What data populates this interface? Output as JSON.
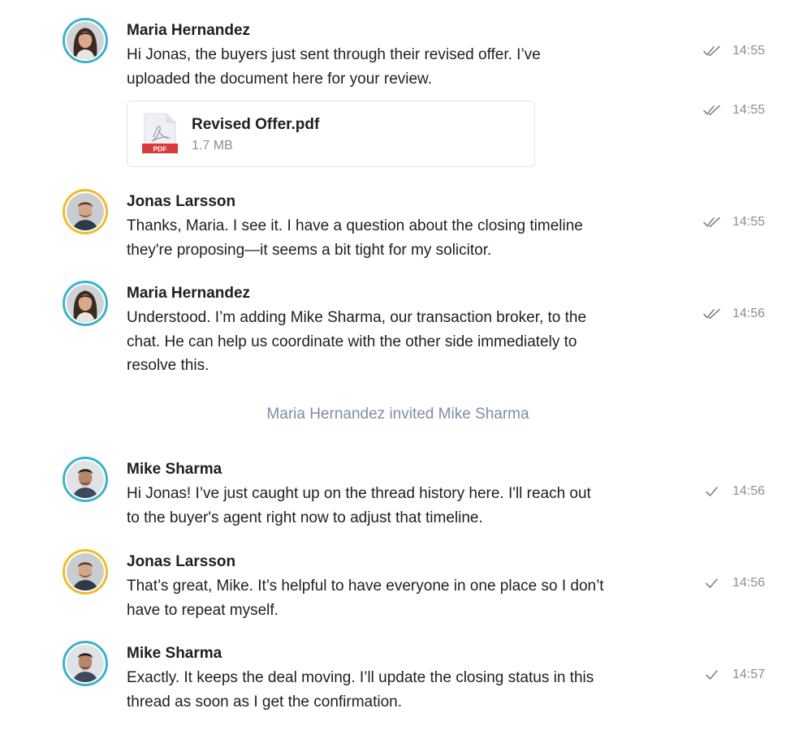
{
  "messages": [
    {
      "sender": "Maria Hernandez",
      "lines": [
        "Hi Jonas, the buyers just sent through their revised offer. I’ve",
        "uploaded the document here for your review."
      ],
      "time": "14:55",
      "status": "read",
      "avatar": "maria-avatar"
    },
    {
      "attachment": {
        "name": "Revised Offer.pdf",
        "size": "1.7 MB",
        "badge": "PDF"
      },
      "time": "14:55",
      "status": "read"
    },
    {
      "sender": "Jonas Larsson",
      "lines": [
        "Thanks, Maria. I see it. I have a question about the closing timeline",
        "they're proposing—it seems a bit tight for my solicitor."
      ],
      "time": "14:55",
      "status": "read",
      "avatar": "jonas-avatar"
    },
    {
      "sender": "Maria Hernandez",
      "lines": [
        "Understood. I’m adding Mike Sharma, our transaction broker, to the",
        "chat. He can help us coordinate with the other side immediately to",
        "resolve this."
      ],
      "time": "14:56",
      "status": "read",
      "avatar": "maria-avatar"
    },
    {
      "sender": "Mike Sharma",
      "lines": [
        "Hi Jonas! I’ve just caught up on the thread history here. I'll reach out",
        "to the buyer's agent right now to adjust that timeline."
      ],
      "time": "14:56",
      "status": "sent",
      "avatar": "mike-avatar"
    },
    {
      "sender": "Jonas Larsson",
      "lines": [
        "That’s great, Mike. It’s helpful to have everyone in one place so I don’t",
        "have to repeat myself."
      ],
      "time": "14:56",
      "status": "sent",
      "avatar": "jonas-avatar"
    },
    {
      "sender": "Mike Sharma",
      "lines": [
        "Exactly. It keeps the deal moving. I’ll update the closing status in this",
        "thread as soon as I get the confirmation."
      ],
      "time": "14:57",
      "status": "sent",
      "avatar": "mike-avatar"
    }
  ],
  "system_message": "Maria Hernandez invited Mike Sharma",
  "colors": {
    "avatar_ring_blue": "#3fb1cc",
    "avatar_ring_gold": "#f2bb2c",
    "meta_gray": "#8a8f97",
    "system_text": "#7e8ea6",
    "pdf_red": "#d93a3a"
  }
}
